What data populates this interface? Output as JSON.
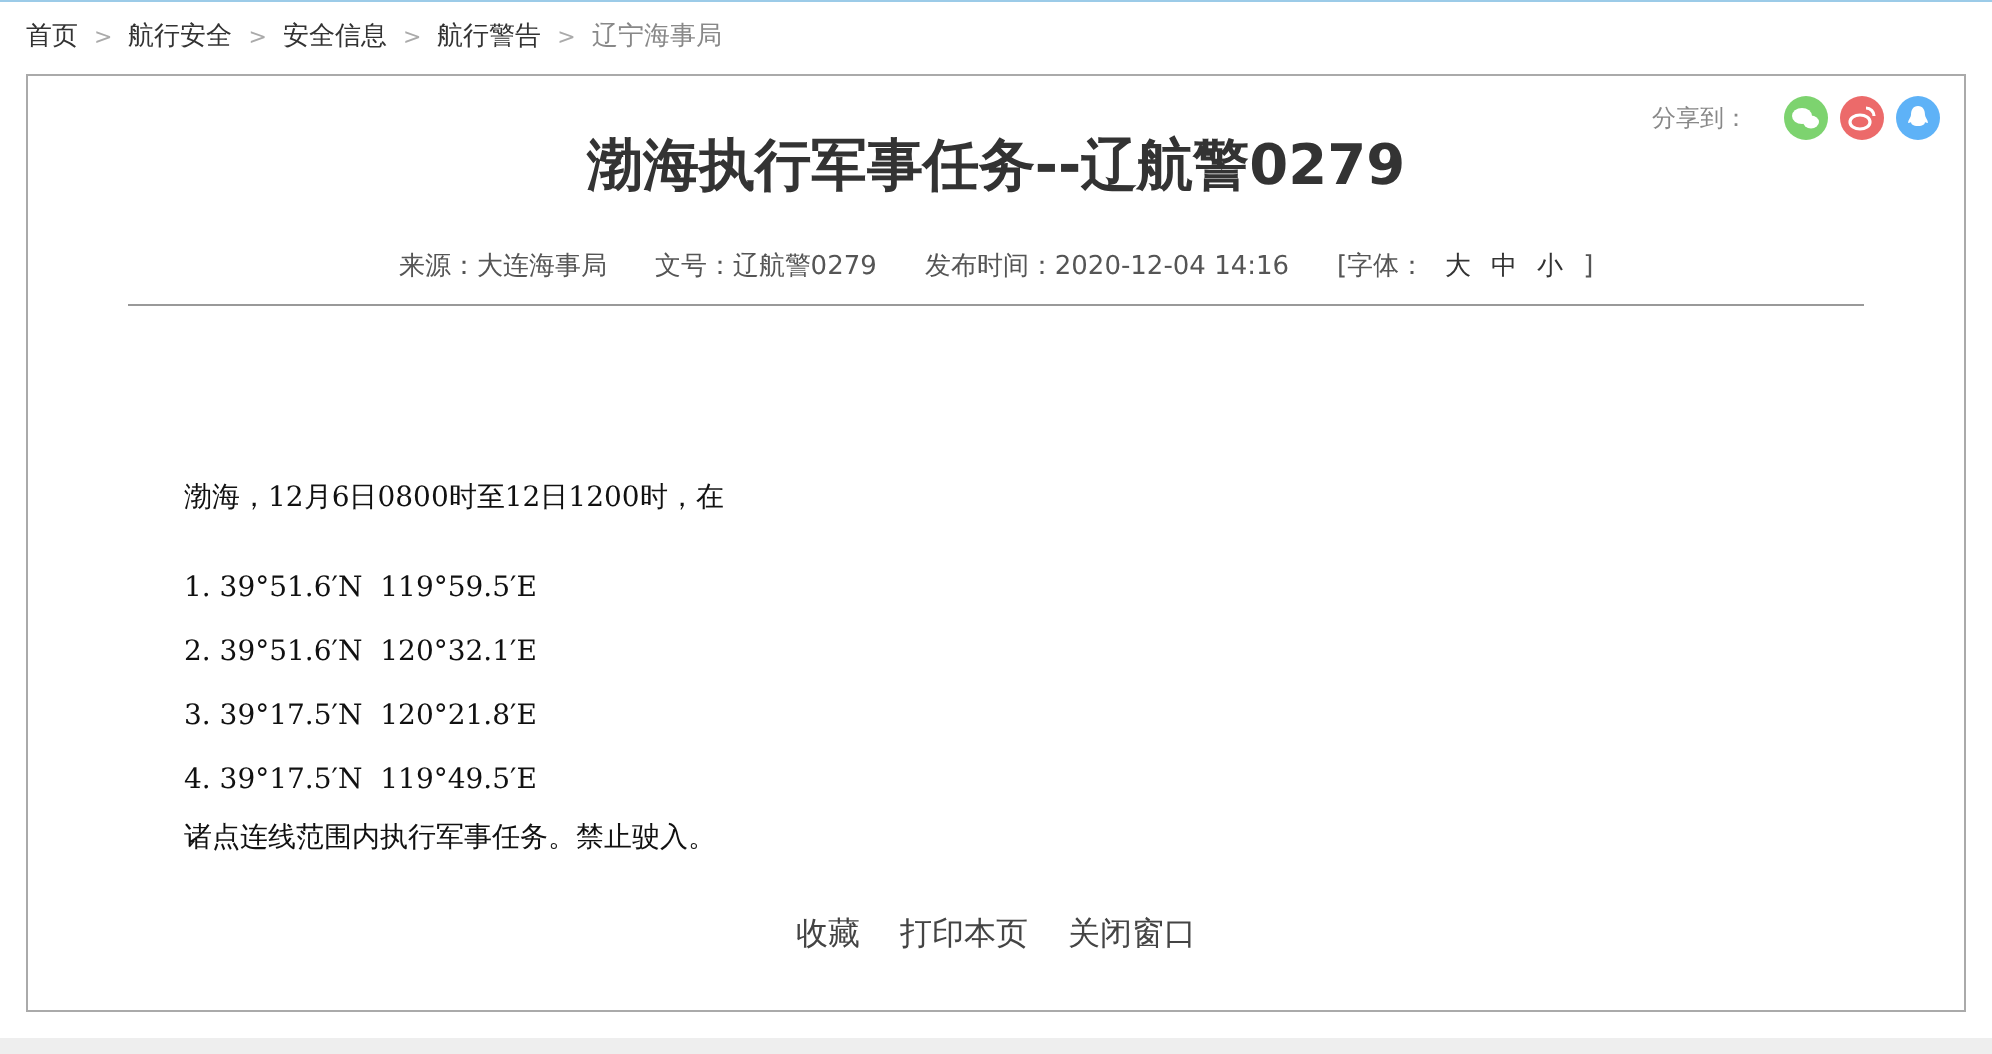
{
  "breadcrumb": [
    {
      "label": "首页",
      "current": false
    },
    {
      "label": "航行安全",
      "current": false
    },
    {
      "label": "安全信息",
      "current": false
    },
    {
      "label": "航行警告",
      "current": false
    },
    {
      "label": "辽宁海事局",
      "current": true
    }
  ],
  "breadcrumb_separator": ">",
  "share": {
    "label": "分享到："
  },
  "article": {
    "title": "渤海执行军事任务--辽航警0279",
    "meta": [
      {
        "kind": "text",
        "text": "来源：大连海事局"
      },
      {
        "kind": "text",
        "text": "文号：辽航警0279"
      },
      {
        "kind": "text",
        "text": "发布时间：2020-12-04 14:16"
      },
      {
        "kind": "fontsize",
        "open": "[字体：",
        "sizes": [
          "大",
          "中",
          "小"
        ],
        "close": "]"
      }
    ],
    "intro": "渤海，12月6日0800时至12日1200时，在",
    "points": [
      "1. 39°51.6′N  119°59.5′E",
      "2. 39°51.6′N  120°32.1′E",
      "3. 39°17.5′N  120°21.8′E",
      "4. 39°17.5′N  119°49.5′E"
    ],
    "closing": "诸点连线范围内执行军事任务。禁止驶入。",
    "actions": [
      "收藏",
      "打印本页",
      "关闭窗口"
    ]
  }
}
